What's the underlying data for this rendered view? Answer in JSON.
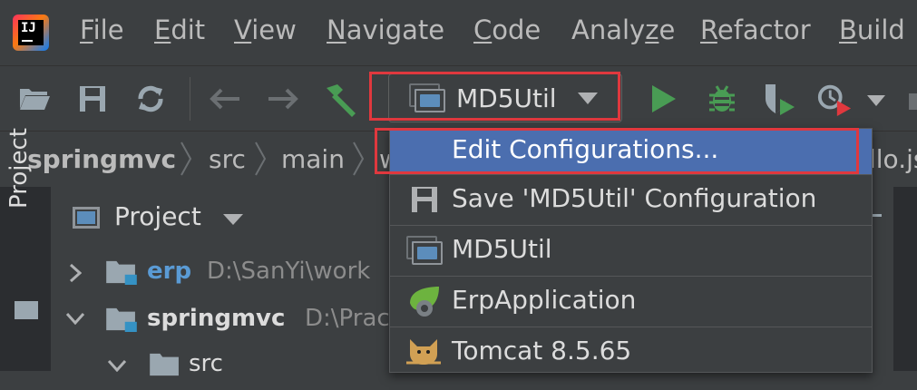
{
  "menu": {
    "items": [
      {
        "pre": "",
        "ul": "F",
        "post": "ile"
      },
      {
        "pre": "",
        "ul": "E",
        "post": "dit"
      },
      {
        "pre": "",
        "ul": "V",
        "post": "iew"
      },
      {
        "pre": "",
        "ul": "N",
        "post": "avigate"
      },
      {
        "pre": "",
        "ul": "C",
        "post": "ode"
      },
      {
        "pre": "Analy",
        "ul": "z",
        "post": "e"
      },
      {
        "pre": "",
        "ul": "R",
        "post": "efactor"
      },
      {
        "pre": "",
        "ul": "B",
        "post": "uild"
      }
    ],
    "logo_text": "IJ"
  },
  "toolbar": {
    "run_config_label": "MD5Util"
  },
  "breadcrumb": {
    "items": [
      "springmvc",
      "src",
      "main",
      "w"
    ],
    "tail": "llo.js"
  },
  "sidebar": {
    "project_tab": "Project"
  },
  "project_panel": {
    "title": "Project",
    "tree": [
      {
        "name": "erp",
        "path": "D:\\SanYi\\work"
      },
      {
        "name": "springmvc",
        "path": "D:\\Prac"
      },
      {
        "name": "src",
        "path": ""
      }
    ]
  },
  "popup": {
    "items": [
      {
        "label": "Edit Configurations..."
      },
      {
        "label": "Save 'MD5Util' Configuration"
      },
      {
        "label": "MD5Util"
      },
      {
        "label": "ErpApplication"
      },
      {
        "label": "Tomcat 8.5.65"
      }
    ]
  },
  "colors": {
    "background": "#3c3f41",
    "selection": "#4b6eaf",
    "highlight_box": "#e0383e",
    "run_green": "#499c54"
  }
}
